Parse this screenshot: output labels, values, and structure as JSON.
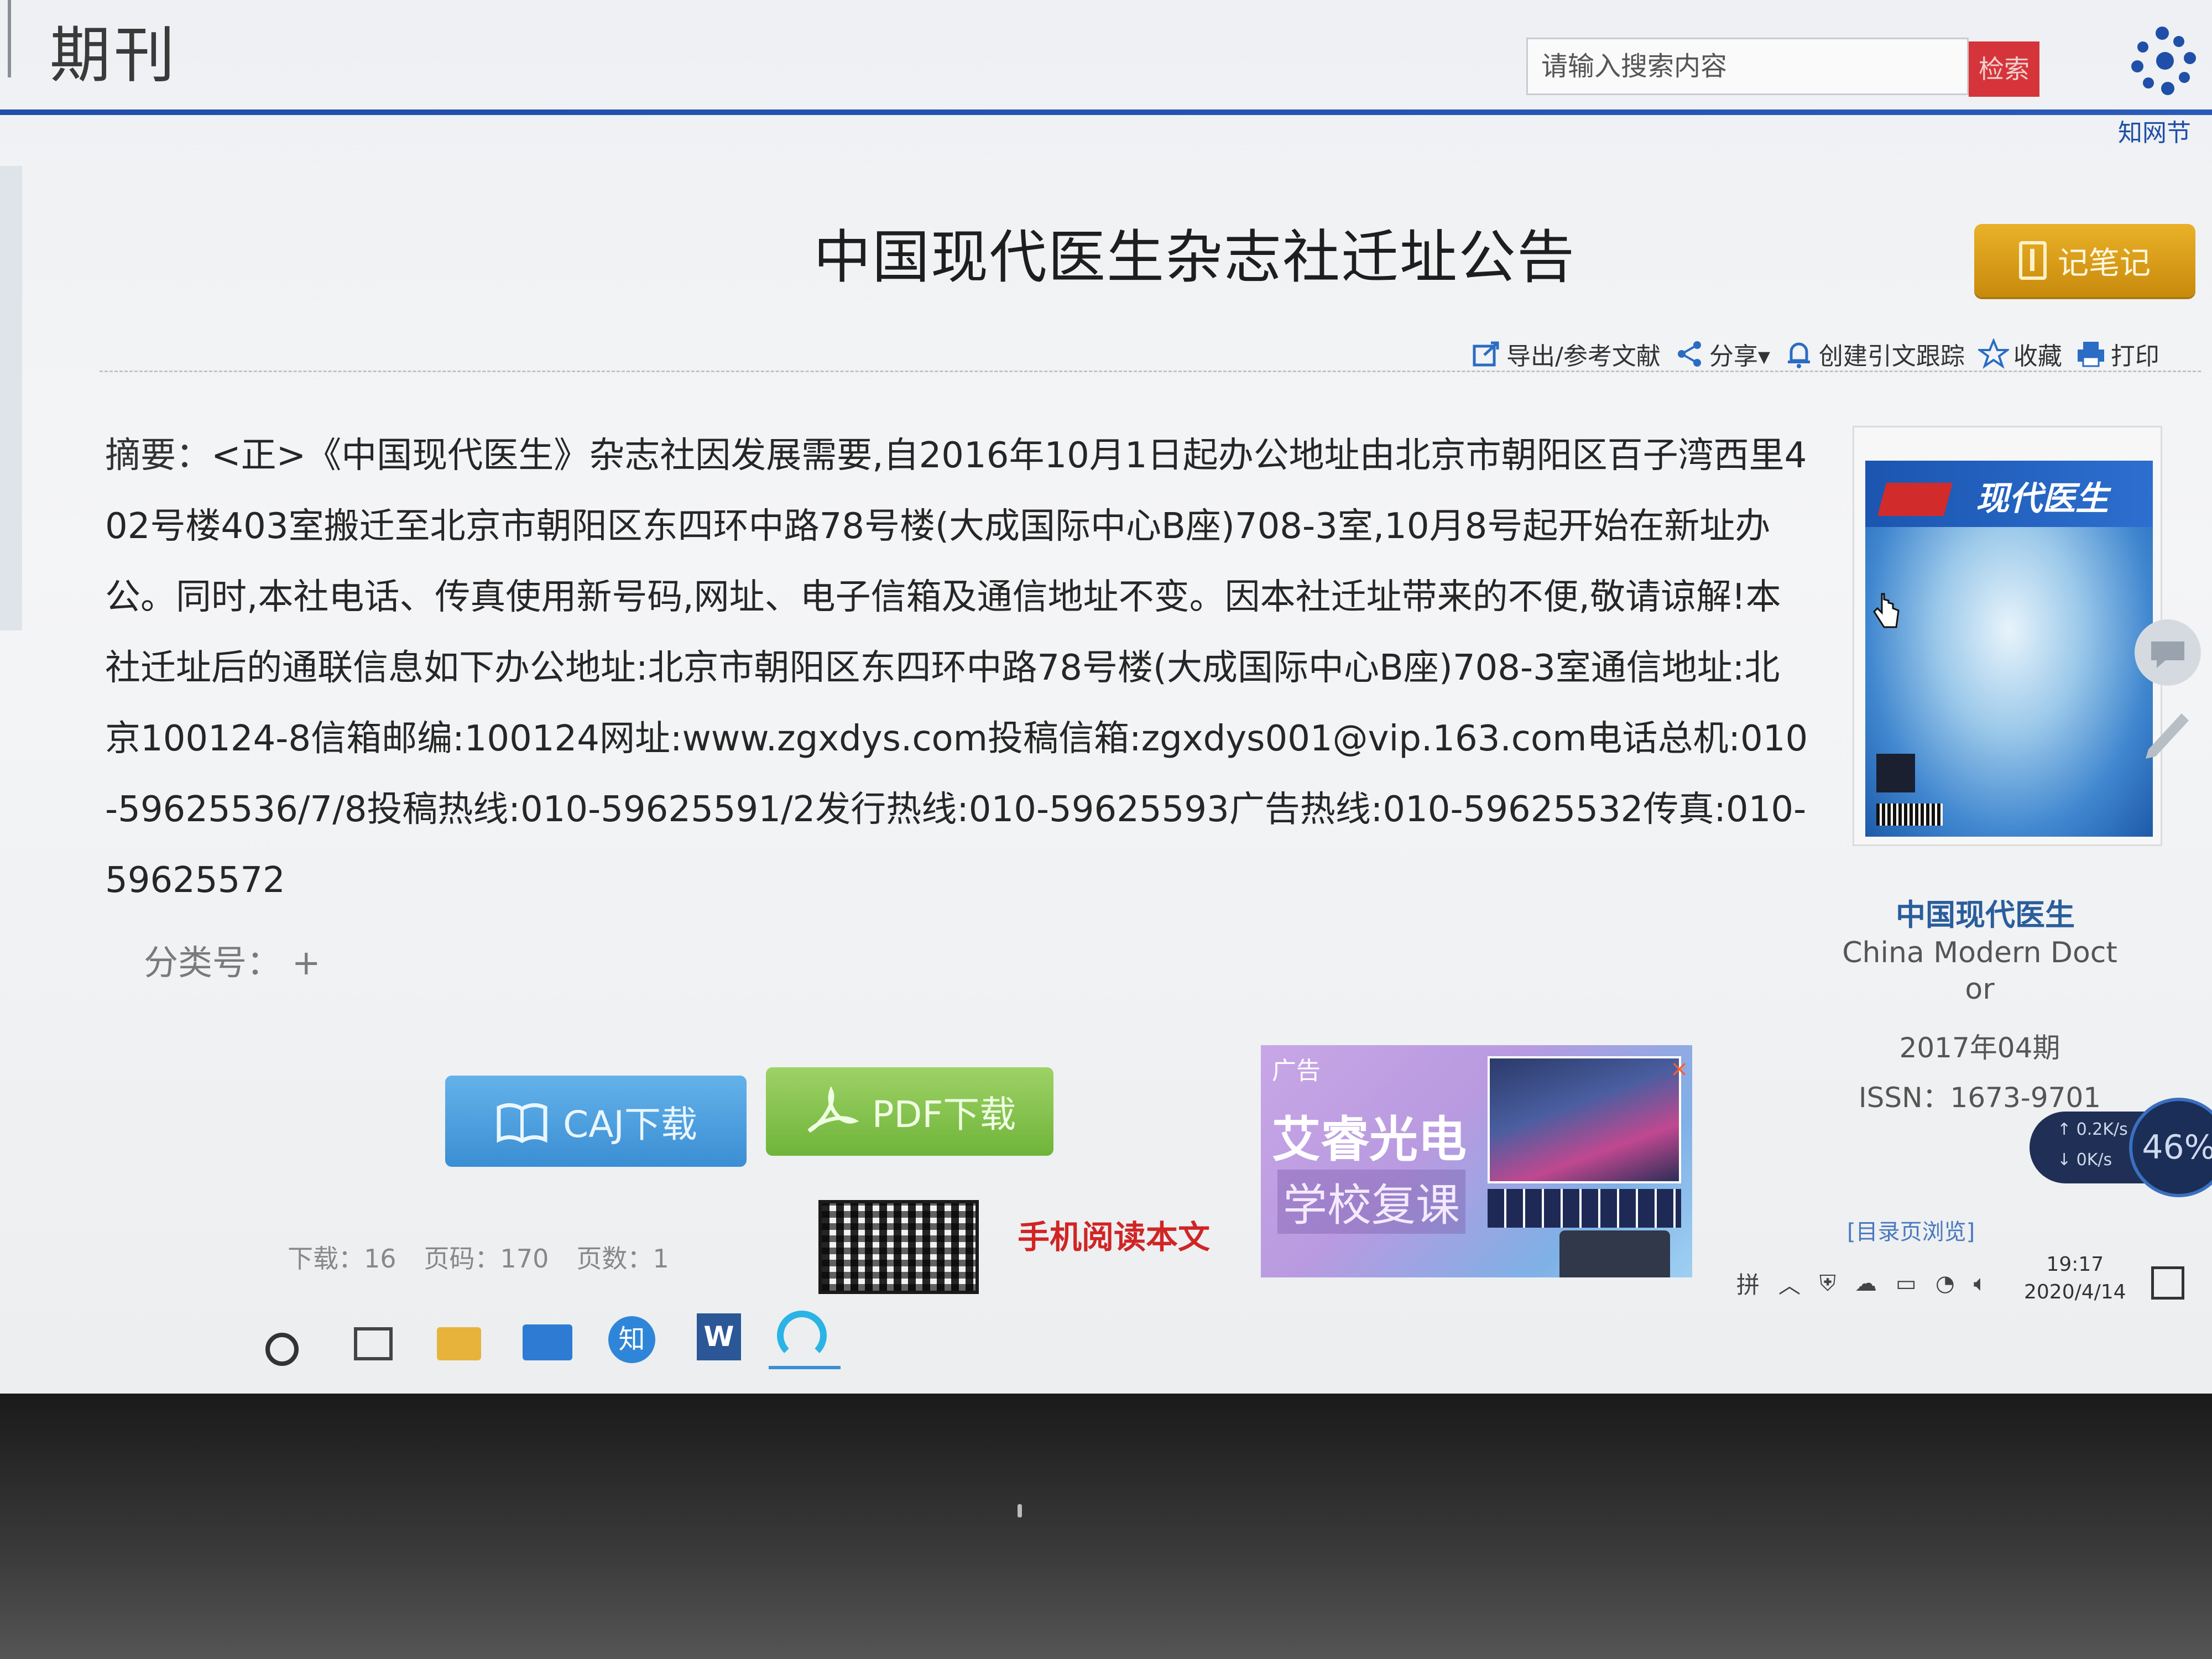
{
  "header": {
    "section_title": "期刊",
    "search_placeholder": "请输入搜索内容",
    "search_button": "检索",
    "logo_text": "知网节"
  },
  "article": {
    "title": "中国现代医生杂志社迁址公告",
    "note_button": "记笔记",
    "toolbar": {
      "export": "导出/参考文献",
      "share": "分享▾",
      "track": "创建引文跟踪",
      "favorite": "收藏",
      "print": "打印"
    },
    "abstract_label": "摘要：",
    "abstract_text": "<正>《中国现代医生》杂志社因发展需要,自2016年10月1日起办公地址由北京市朝阳区百子湾西里402号楼403室搬迁至北京市朝阳区东四环中路78号楼(大成国际中心B座)708-3室,10月8号起开始在新址办公。同时,本社电话、传真使用新号码,网址、电子信箱及通信地址不变。因本社迁址带来的不便,敬请谅解!本社迁址后的通联信息如下办公地址:北京市朝阳区东四环中路78号楼(大成国际中心B座)708-3室通信地址:北京100124-8信箱邮编:100124网址:www.zgxdys.com投稿信箱:zgxdys001@vip.163.com电话总机:010-59625536/7/8投稿热线:010-59625591/2发行热线:010-59625593广告热线:010-59625532传真:010-59625572",
    "classification": "分类号： +"
  },
  "downloads": {
    "caj": "CAJ下载",
    "pdf": "PDF下载",
    "stats": {
      "downloads": "下载：16",
      "page_no": "页码：170",
      "pages": "页数：1"
    },
    "mobile_read": "手机阅读本文"
  },
  "journal": {
    "cover_title": "现代医生",
    "name_cn": "中国现代医生",
    "name_en": "China Modern Doct or",
    "issue": "2017年04期",
    "issn": "ISSN：1673-9701",
    "toc_link": "[目录页浏览]"
  },
  "ad": {
    "tag": "广告",
    "headline": "艾睿光电",
    "subline": "学校复课",
    "close": "×"
  },
  "taskbar": {
    "zhi_label": "知",
    "word_label": "W",
    "ime": "拼",
    "time": "19:17",
    "date": "2020/4/14"
  },
  "speed_widget": {
    "up": "↑ 0.2K/s",
    "down": "↓ 0K/s",
    "percent": "46%"
  },
  "colors": {
    "header_rule": "#2454b0",
    "search_button": "#d5353a",
    "note_button": "#d89a18",
    "caj_button": "#4a9be0",
    "pdf_button": "#86c350",
    "mobile_read": "#d02525",
    "journal_name": "#2a5d9b"
  }
}
